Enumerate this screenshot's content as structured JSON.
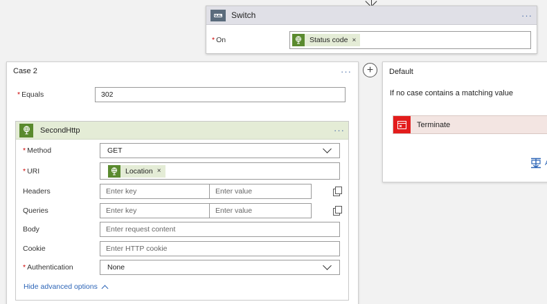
{
  "switch": {
    "title": "Switch",
    "menu": "···",
    "on_label": "On",
    "token": "Status code",
    "token_remove": "×"
  },
  "case2": {
    "title": "Case 2",
    "menu": "···",
    "equals_label": "Equals",
    "equals_value": "302",
    "add_symbol": "+"
  },
  "http": {
    "title": "SecondHttp",
    "menu": "···",
    "method_label": "Method",
    "method_value": "GET",
    "uri_label": "URI",
    "uri_token": "Location",
    "uri_token_remove": "×",
    "headers_label": "Headers",
    "headers_key_placeholder": "Enter key",
    "headers_value_placeholder": "Enter value",
    "queries_label": "Queries",
    "queries_key_placeholder": "Enter key",
    "queries_value_placeholder": "Enter value",
    "body_label": "Body",
    "body_placeholder": "Enter request content",
    "cookie_label": "Cookie",
    "cookie_placeholder": "Enter HTTP cookie",
    "auth_label": "Authentication",
    "auth_value": "None",
    "advanced_link": "Hide advanced options"
  },
  "default": {
    "title": "Default",
    "description": "If no case contains a matching value",
    "terminate_label": "Terminate",
    "add_action_label": "A"
  },
  "colors": {
    "http_green": "#5a8a2e",
    "terminate_red": "#e31c1c",
    "link_blue": "#2a63b6",
    "required_red": "#cc0000"
  }
}
